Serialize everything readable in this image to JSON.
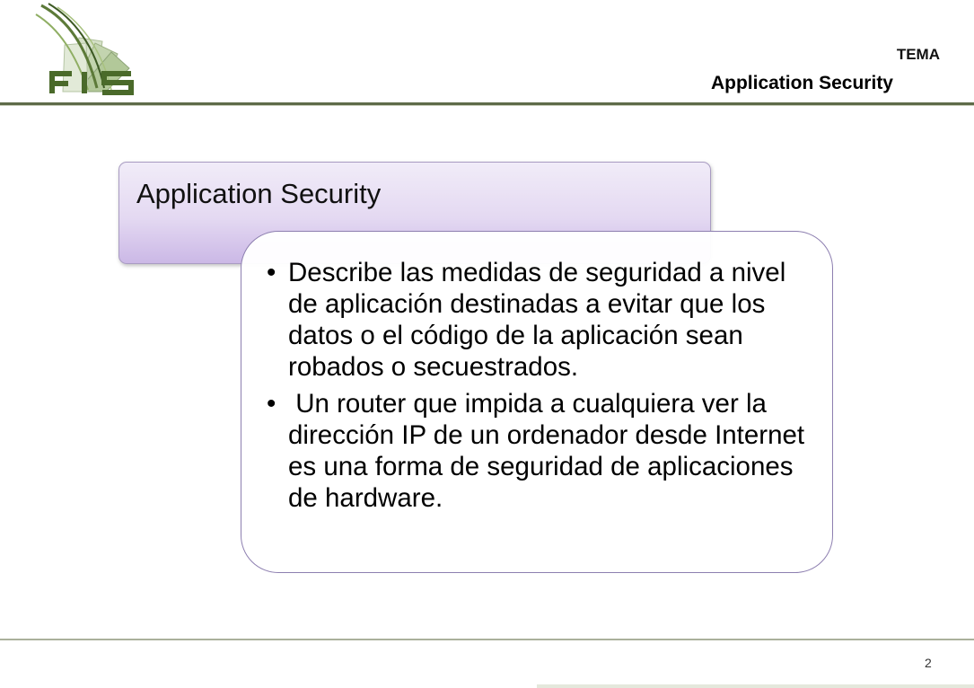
{
  "header": {
    "logo_text": "FIS",
    "tema_label": "TEMA",
    "title": "Application Security"
  },
  "slide": {
    "title": "Application Security",
    "bullets": [
      {
        "marker": "•",
        "text": "Describe las medidas de seguridad a nivel de aplicación destinadas a evitar que los datos o el código de la aplicación sean robados o secuestrados."
      },
      {
        "marker": "•",
        "text": " Un router que impida a cualquiera ver la dirección IP de un ordenador desde Internet es una forma de seguridad de aplicaciones de hardware."
      }
    ]
  },
  "footer": {
    "page_number": "2"
  },
  "colors": {
    "accent_green": "#5e6b49",
    "logo_green": "#4a6a2a",
    "title_box_purple": "#cbb8e6",
    "content_border": "#8d7fb0"
  }
}
